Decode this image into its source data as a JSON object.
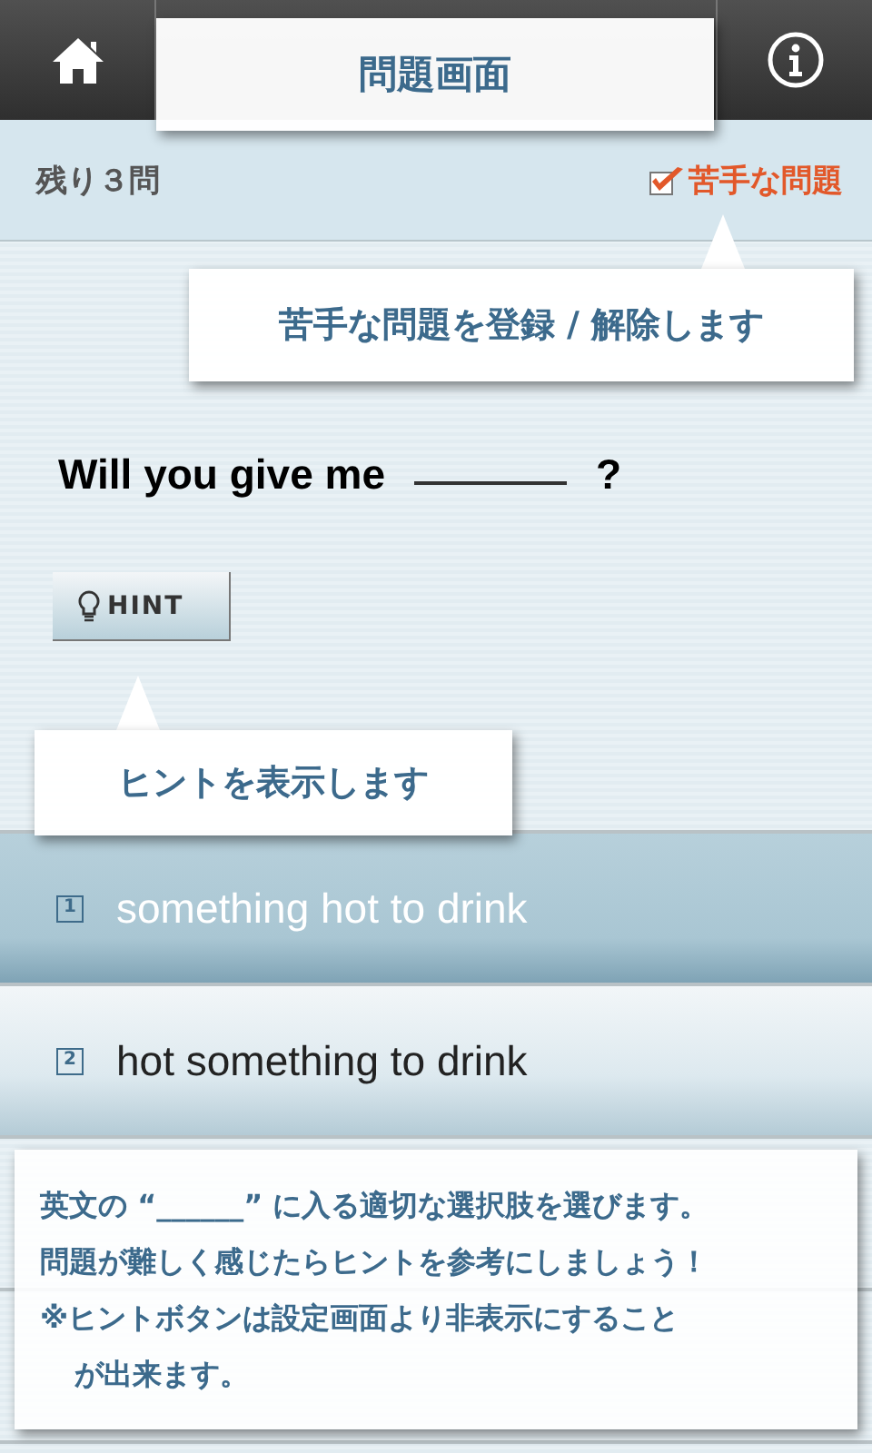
{
  "status": {
    "remaining": "残り３問",
    "weak": {
      "label": "苦手な問題",
      "checked": true
    }
  },
  "question": {
    "before": "Will you give me",
    "after": "?"
  },
  "hint_button": {
    "label": "HINT"
  },
  "options": [
    {
      "number": "1",
      "text": "something hot to drink",
      "selected": true
    },
    {
      "number": "2",
      "text": "hot something to drink",
      "selected": false
    }
  ],
  "tutorial": {
    "screen_title": "問題画面",
    "weak_note": "苦手な問題を登録 / 解除します",
    "hint_note": "ヒントを表示します",
    "instructions": [
      "英文の “______” に入る適切な選択肢を選びます。",
      "問題が難しく感じたらヒントを参考にしましょう！",
      "※ヒントボタンは設定画面より非表示にすることが出来ます。"
    ]
  }
}
